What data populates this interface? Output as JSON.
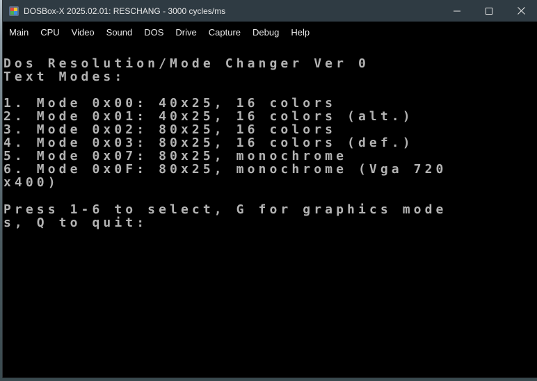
{
  "window": {
    "title": "DOSBox-X 2025.02.01: RESCHANG - 3000 cycles/ms",
    "icon": "dosbox-icon"
  },
  "controls": {
    "minimize": "minimize-icon",
    "maximize": "maximize-icon",
    "close": "close-icon"
  },
  "menu": [
    {
      "label": "Main"
    },
    {
      "label": "CPU"
    },
    {
      "label": "Video"
    },
    {
      "label": "Sound"
    },
    {
      "label": "DOS"
    },
    {
      "label": "Drive"
    },
    {
      "label": "Capture"
    },
    {
      "label": "Debug"
    },
    {
      "label": "Help"
    }
  ],
  "screen": {
    "text_color": "#b3b3b3",
    "lines": [
      "Dos Resolution/Mode Changer Ver 0",
      "Text Modes:",
      "",
      "1. Mode 0x00: 40x25, 16 colors",
      "2. Mode 0x01: 40x25, 16 colors (alt.)",
      "3. Mode 0x02: 80x25, 16 colors",
      "4. Mode 0x03: 80x25, 16 colors (def.)",
      "5. Mode 0x07: 80x25, monochrome",
      "6. Mode 0x0F: 80x25, monochrome (Vga 720",
      "x400)",
      "",
      "Press 1-6 to select, G for graphics mode",
      "s, Q to quit:"
    ]
  }
}
